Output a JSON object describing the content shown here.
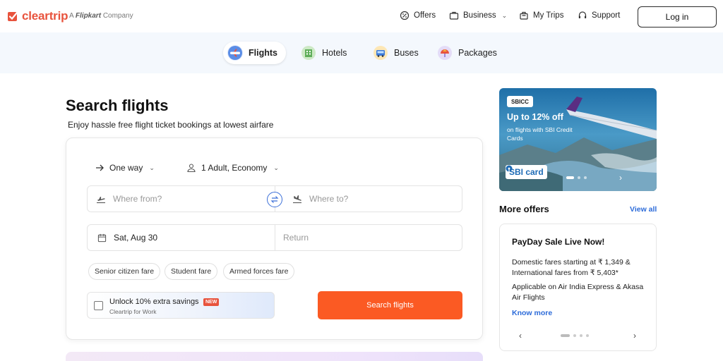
{
  "brand": {
    "name": "cleartrip",
    "tagline_prefix": "A",
    "tagline_brand": "Flipkart",
    "tagline_suffix": "Company",
    "color": "#e8533d"
  },
  "header": {
    "nav": [
      {
        "label": "Offers",
        "icon": "offers-icon"
      },
      {
        "label": "Business",
        "icon": "briefcase-icon"
      },
      {
        "label": "My Trips",
        "icon": "trips-icon"
      },
      {
        "label": "Support",
        "icon": "headset-icon"
      }
    ],
    "login_label": "Log in"
  },
  "categories": [
    {
      "label": "Flights",
      "icon": "flight-icon",
      "active": true
    },
    {
      "label": "Hotels",
      "icon": "hotel-icon",
      "active": false
    },
    {
      "label": "Buses",
      "icon": "bus-icon",
      "active": false
    },
    {
      "label": "Packages",
      "icon": "package-icon",
      "active": false
    }
  ],
  "search": {
    "title": "Search flights",
    "subtitle": "Enjoy hassle free flight ticket bookings at lowest airfare",
    "trip_type": "One way",
    "travellers": "1 Adult, Economy",
    "from_placeholder": "Where from?",
    "to_placeholder": "Where to?",
    "depart_date": "Sat, Aug 30",
    "return_placeholder": "Return",
    "fare_chips": [
      "Senior citizen fare",
      "Student fare",
      "Armed forces fare"
    ],
    "unlock_title": "Unlock 10% extra savings",
    "unlock_badge": "NEW",
    "unlock_sub": "Cleartrip for Work",
    "search_button": "Search flights",
    "accent": "#fb5a23"
  },
  "banner": {
    "tag": "SBICC",
    "headline": "Up to 12% off",
    "sub": "on flights with SBI Credit Cards",
    "logo_text": "SBI card",
    "slide_count": 3,
    "active_slide": 0
  },
  "offers": {
    "heading": "More offers",
    "view_all": "View all",
    "card": {
      "title": "PayDay Sale Live Now!",
      "line1": "Domestic fares starting at ₹ 1,349 & International fares from ₹ 5,403*",
      "line2": "Applicable on Air India Express & Akasa Air Flights",
      "link": "Know more"
    },
    "slide_count": 4,
    "active_slide": 0
  }
}
